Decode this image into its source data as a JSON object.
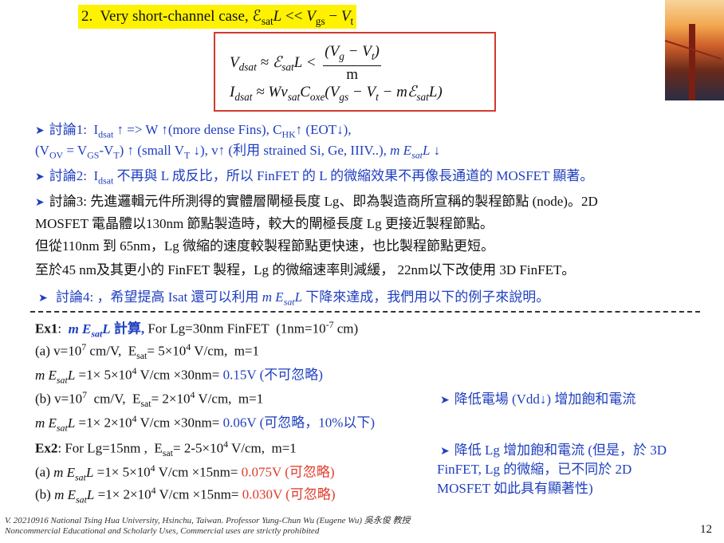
{
  "heading": "2. Very short-channel case, ℰsatL << Vgs − Vt",
  "formulas": {
    "line1_left": "Vdsat ≈ ℰsatL <",
    "line1_num": "(Vg − Vt)",
    "line1_den": "m",
    "line2": "Idsat ≈ Wvsat Coxe(Vgs − Vt − mℰsatL)"
  },
  "bullets": [
    "討論1:  Idsat ↑ => W ↑(more dense Fins), CHK↑ (EOT↓),",
    "(VOV = VGS-VT) ↑ (small VT ↓), v↑ (利用 strained Si, Ge, IIIV..), m EsatL ↓",
    "討論2:  Idsat 不再與 L 成反比，所以 FinFET 的 L 的微縮效果不再像長通道的 MOSFET 顯著。",
    "討論3:  先進邏輯元件所測得的實體層閘極長度 Lg、即為製造商所宣稱的製程節點 (node)。2D",
    "MOSFET 電晶體以130nm 節點製造時，較大的閘極長度 Lg 更接近製程節點。",
    "但從110nm 到 65nm，Lg 微縮的速度較製程節點更快速，也比製程節點更短。",
    "至於45 nm及其更小的 FinFET 製程，Lg 的微縮速率則減緩， 22nm以下改使用 3D FinFET。",
    "討論4: ，希望提高 Isat 還可以利用 m EsatL 下降來達成，我們用以下的例子來說明。"
  ],
  "ex1": {
    "title": "Ex1:  m EsatL 計算,",
    "cond": " For Lg=30nm FinFET  (1nm=10-7 cm)",
    "a": "(a) v=107 cm/V,  Esat= 5×104 V/cm,  m=1",
    "a_calc": "m EsatL =1× 5×104 V/cm ×30nm=",
    "a_result": "0.15V (不可忽略)",
    "b": "(b) v=107  cm/V,  Esat= 2×104 V/cm,  m=1",
    "b_calc": "m EsatL =1× 2×104 V/cm ×30nm=",
    "b_result": "0.06V (可忽略，10%以下)"
  },
  "ex2": {
    "title": "Ex2:",
    "cond": " For Lg=15nm ,  Esat= 2-5×104 V/cm,  m=1",
    "a_calc": "(a) m EsatL =1× 5×104 V/cm ×15nm=",
    "a_result": "0.075V (可忽略)",
    "b_calc": "(b) m EsatL =1× 2×104 V/cm ×15nm=",
    "b_result": "0.030V (可忽略)"
  },
  "notes": {
    "note1": "降低電場 (Vdd↓) 增加飽和電流",
    "note2_l1": "降低 Lg 增加飽和電流 (但是，於 3D",
    "note2_l2": "FinFET, Lg 的微縮，已不同於 2D",
    "note2_l3": "MOSFET 如此具有顯著性)"
  },
  "footer": {
    "line1": "V. 20210916 National Tsing Hua University, Hsinchu, Taiwan. Professor Yung-Chun Wu (Eugene Wu) 吳永俊 教授",
    "line2": "Noncommercial Educational and Scholarly Uses, Commercial uses are strictly prohibited"
  },
  "page_number": "12"
}
